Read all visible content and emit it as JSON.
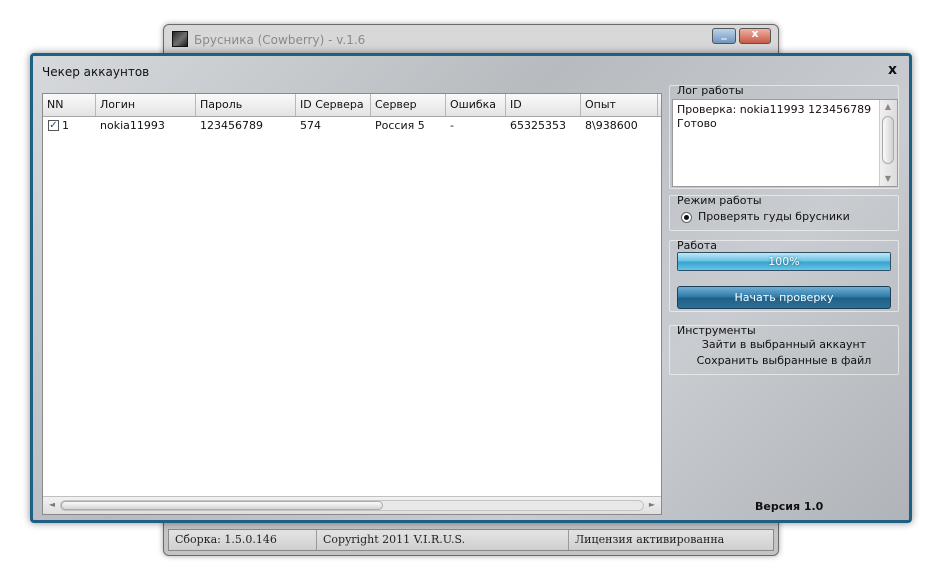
{
  "main_window": {
    "title": "Брусника (Cowberry) - v.1.6",
    "minimize_glyph": "_",
    "close_glyph": "x",
    "status": {
      "build": "Сборка: 1.5.0.146",
      "copyright": "Copyright 2011 V.I.R.U.S.",
      "license": "Лицензия активированна"
    }
  },
  "dialog": {
    "title": "Чекер аккаунтов",
    "close_glyph": "x",
    "table": {
      "columns": [
        "NN",
        "Логин",
        "Пароль",
        "ID Сервера",
        "Сервер",
        "Ошибка",
        "ID",
        "Опыт",
        ""
      ],
      "rows": [
        {
          "checked": true,
          "num": "1",
          "login": "nokia11993",
          "password": "123456789",
          "server_id": "574",
          "server": "Россия 5",
          "error": "-",
          "id": "65325353",
          "exp": "8\\938600"
        }
      ]
    },
    "log": {
      "title": "Лог работы",
      "text": "Проверка: nokia11993 123456789\nГотово"
    },
    "mode": {
      "title": "Режим работы",
      "option": "Проверять гуды брусники"
    },
    "work": {
      "title": "Работа",
      "progress_percent": 100,
      "progress_label": "100%",
      "start_button": "Начать проверку"
    },
    "tools": {
      "title": "Инструменты",
      "login_selected": "Зайти в выбранный аккаунт",
      "save_selected": "Сохранить выбранные в файл"
    },
    "version": "Версия 1.0"
  },
  "colors": {
    "dialog_border": "#1f5f84",
    "progress": "#3aa2cc",
    "button": "#2a78a6"
  },
  "icons": {
    "app": "app-logo-icon",
    "checkbox": "checkmark-icon"
  }
}
